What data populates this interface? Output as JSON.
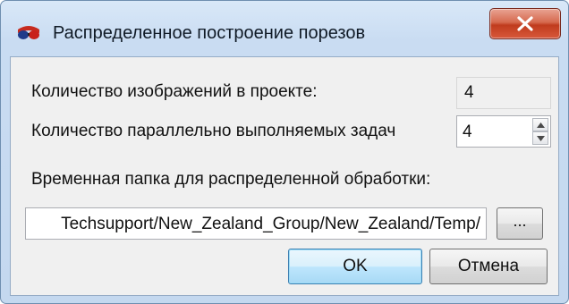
{
  "window": {
    "title": "Распределенное построение порезов",
    "app_icon": "stereo-glasses-icon",
    "close_icon": "close-icon"
  },
  "form": {
    "images_count_label": "Количество изображений в проекте:",
    "images_count_value": "4",
    "parallel_tasks_label": "Количество параллельно выполняемых задач",
    "parallel_tasks_value": "4",
    "temp_folder_label": "Временная папка для распределенной обработки:",
    "temp_folder_value": "Techsupport/New_Zealand_Group/New_Zealand/Temp/",
    "browse_label": "..."
  },
  "buttons": {
    "ok": "OK",
    "cancel": "Отмена"
  },
  "colors": {
    "title_frame": "#c9dcf2",
    "close_button": "#c03c1e",
    "client_background": "#f0f0f0",
    "ok_button_border": "#3c7fb1"
  }
}
